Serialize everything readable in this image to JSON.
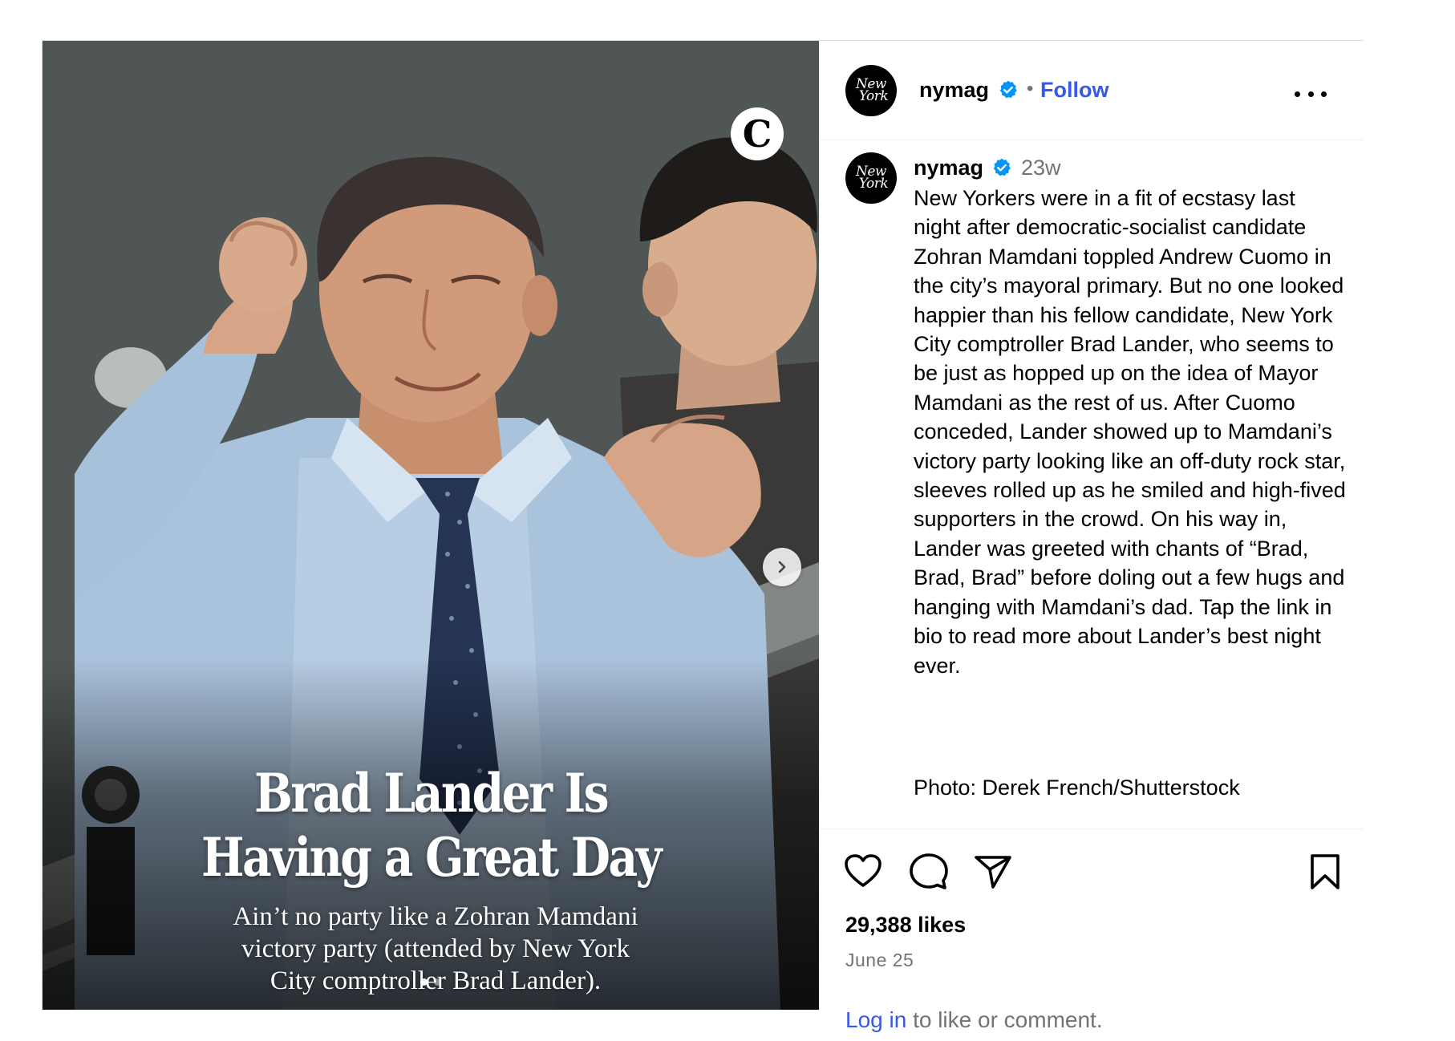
{
  "account": {
    "username": "nymag",
    "avatar_text": [
      "New",
      "York"
    ],
    "follow_label": "Follow",
    "separator": "•"
  },
  "media": {
    "badge_letter": "C",
    "headline": [
      "Brad Lander Is",
      "Having a Great Day"
    ],
    "dek": "Ain’t no party like a Zohran Mamdani victory party (attended by New York City comptroller Brad Lander).",
    "carousel_dots": 2,
    "active_dot": 0
  },
  "caption": {
    "username": "nymag",
    "age": "23w",
    "text": "New Yorkers were in a fit of ecstasy last night after democratic-socialist candidate Zohran Mamdani toppled Andrew Cuomo in the city’s mayoral primary. But no one looked happier than his fellow candidate, New York City comptroller Brad Lander, who seems to be just as hopped up on the idea of Mayor Mamdani as the rest of us. After Cuomo conceded, Lander showed up to Mamdani’s victory party looking like an off-duty rock star, sleeves rolled up as he smiled and high-fived supporters in the crowd. On his way in, Lander was greeted with chants of “Brad, Brad, Brad” before doling out a few hugs and hanging with Mamdani’s dad. Tap the link in bio to read more about Lander’s best night ever.",
    "credit": "Photo: Derek French/Shutterstock"
  },
  "engagement": {
    "likes": "29,388 likes",
    "date": "June 25",
    "login_link": "Log in",
    "login_rest": " to like or comment."
  },
  "icons": {
    "like": "heart-icon",
    "comment": "comment-icon",
    "share": "share-icon",
    "save": "bookmark-icon",
    "next": "chevron-right-icon",
    "verified": "verified-badge-icon",
    "more": "more-options-icon"
  },
  "colors": {
    "link_blue": "#3858e9",
    "verified_blue": "#0095f6",
    "muted_text": "#737373",
    "border": "#dbdbdb"
  }
}
